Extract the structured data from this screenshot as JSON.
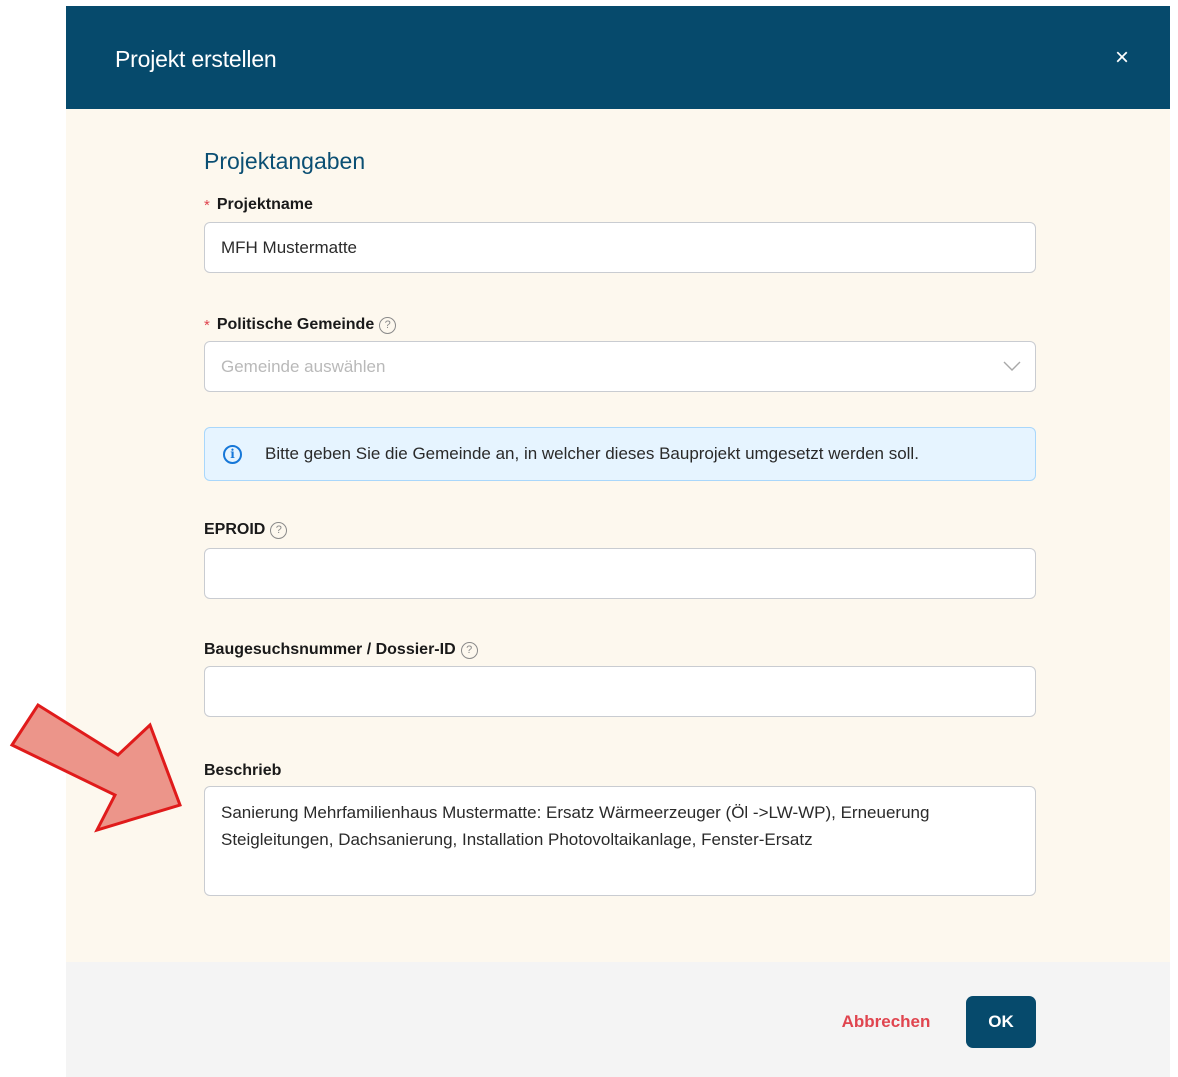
{
  "dialog": {
    "title": "Projekt erstellen",
    "close_symbol": "×"
  },
  "section": {
    "title": "Projektangaben"
  },
  "fields": {
    "projektname": {
      "required_mark": "*",
      "label": "Projektname",
      "value": "MFH Mustermatte"
    },
    "gemeinde": {
      "required_mark": "*",
      "label": "Politische Gemeinde",
      "placeholder": "Gemeinde auswählen",
      "help_symbol": "?"
    },
    "info": {
      "icon_symbol": "i",
      "text": "Bitte geben Sie die Gemeinde an, in welcher dieses Bauprojekt umgesetzt werden soll."
    },
    "eproid": {
      "label": "EPROID",
      "value": "",
      "help_symbol": "?"
    },
    "baugesuch": {
      "label": "Baugesuchsnummer / Dossier-ID",
      "value": "",
      "help_symbol": "?"
    },
    "beschrieb": {
      "label": "Beschrieb",
      "value": "Sanierung Mehrfamilienhaus Mustermatte: Ersatz Wärmeerzeuger (Öl ->LW-WP), Erneuerung Steigleitungen, Dachsanierung, Installation Photovoltaikanlage, Fenster-Ersatz"
    }
  },
  "footer": {
    "cancel_label": "Abbrechen",
    "ok_label": "OK"
  },
  "colors": {
    "header_bg": "#064a6c",
    "body_bg": "#fdf8ee",
    "required": "#e0454f",
    "accent": "#0b4f73",
    "info_bg": "#e6f4ff",
    "info_icon": "#1677d8",
    "annotation_arrow": "#ec958a"
  },
  "icons": [
    "close-icon",
    "help-icon",
    "chevron-down-icon",
    "info-icon",
    "annotation-arrow-icon"
  ]
}
